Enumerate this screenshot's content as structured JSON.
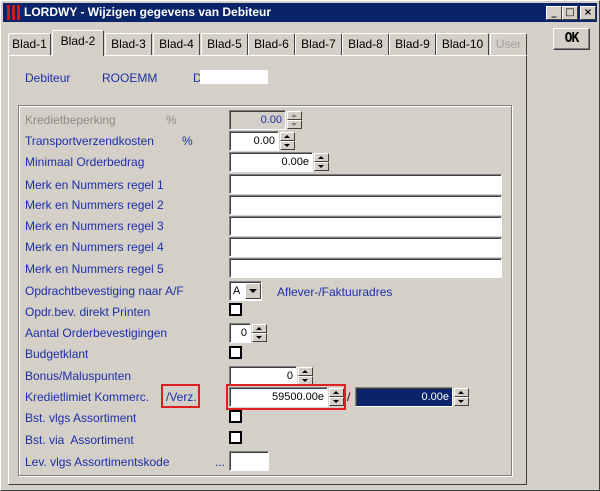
{
  "window": {
    "title": "LORDWY - Wijzigen gegevens van Debiteur",
    "min_symbol": "_",
    "max_symbol": "□",
    "close_symbol": "×"
  },
  "tabs": [
    {
      "label": "Blad-1",
      "active": false
    },
    {
      "label": "Blad-2",
      "active": true
    },
    {
      "label": "Blad-3",
      "active": false
    },
    {
      "label": "Blad-4",
      "active": false
    },
    {
      "label": "Blad-5",
      "active": false
    },
    {
      "label": "Blad-6",
      "active": false
    },
    {
      "label": "Blad-7",
      "active": false
    },
    {
      "label": "Blad-8",
      "active": false
    },
    {
      "label": "Blad-9",
      "active": false
    },
    {
      "label": "Blad-10",
      "active": false
    },
    {
      "label": "User",
      "active": false,
      "disabled": true
    }
  ],
  "ok_button": "OK",
  "header": {
    "debiteur_label": "Debiteur",
    "debiteur_code": "ROOEMM",
    "debiteur_name_prefix": "D",
    "debiteur_name_value": ""
  },
  "form": {
    "kredietbeperking": {
      "label": "Kredietbeperking",
      "unit": "%",
      "value": "0.00"
    },
    "transportverzendkosten": {
      "label": "Transportverzendkosten",
      "unit": "%",
      "value": "0.00"
    },
    "minimaal_orderbedrag": {
      "label": "Minimaal Orderbedrag",
      "value": "0.00e"
    },
    "merk_regel_1": {
      "label": "Merk en Nummers regel 1",
      "value": ""
    },
    "merk_regel_2": {
      "label": "Merk en Nummers regel 2",
      "value": ""
    },
    "merk_regel_3": {
      "label": "Merk en Nummers regel 3",
      "value": ""
    },
    "merk_regel_4": {
      "label": "Merk en Nummers regel 4",
      "value": ""
    },
    "merk_regel_5": {
      "label": "Merk en Nummers regel 5",
      "value": ""
    },
    "opdrachtbevestiging": {
      "label": "Opdrachtbevestiging naar A/F",
      "value": "A",
      "description": "Aflever-/Faktuuradres"
    },
    "opdr_direkt_printen": {
      "label": "Opdr.bev. direkt Printen",
      "checked": false
    },
    "aantal_orderbevestigingen": {
      "label": "Aantal Orderbevestigingen",
      "value": "0"
    },
    "budgetklant": {
      "label": "Budgetklant",
      "checked": false
    },
    "bonus_maluspunten": {
      "label": "Bonus/Maluspunten",
      "value": "0"
    },
    "kredietlimiet": {
      "label_a": "Kredietlimiet Kommerc.",
      "label_b": "/Verz.",
      "value": "59500.00e",
      "separator": "/",
      "value_verz": "0.00e"
    },
    "bst_vlgs_assortiment": {
      "label": "Bst. vlgs Assortiment",
      "checked": false
    },
    "bst_via_assortiment": {
      "label": "Bst. via  Assortiment",
      "checked": false
    },
    "lev_vlgs_assortimentskode": {
      "label": "Lev. vlgs Assortimentskode",
      "ellipsis": "...",
      "value": ""
    }
  },
  "colors": {
    "label_blue": "#1c2fa8",
    "title_bar": "#0a246a",
    "highlight_red": "#e02020",
    "face": "#d4d0c8"
  }
}
